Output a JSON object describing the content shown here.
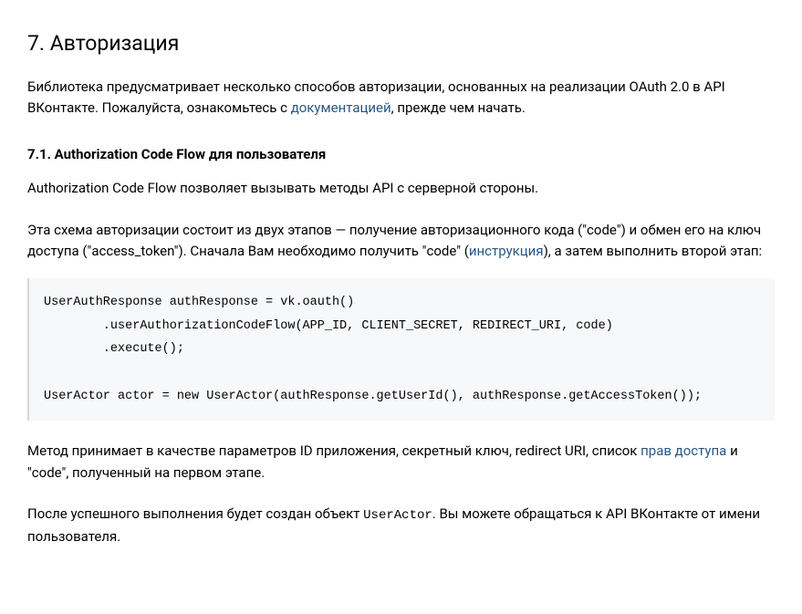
{
  "section": {
    "heading": "7. Авторизация",
    "intro_before_link": "Библиотека предусматривает несколько способов авторизации, основанных на реализации OAuth 2.0 в API ВКонтакте. Пожалуйста, ознакомьтесь с ",
    "intro_link": "документацией",
    "intro_after_link": ", прежде чем начать."
  },
  "subsection": {
    "heading": "7.1. Authorization Code Flow для пользователя",
    "p1": "Authorization Code Flow позволяет вызывать методы API с серверной стороны.",
    "p2_before_link": "Эта схема авторизации состоит из двух этапов — получение авторизационного кода (\"code\") и обмен его на ключ доступа (\"access_token\"). Сначала Вам необходимо получить \"code\" (",
    "p2_link": "инструкция",
    "p2_after_link": "), а затем выполнить второй этап:",
    "codeblock": "UserAuthResponse authResponse = vk.oauth()\n        .userAuthorizationCodeFlow(APP_ID, CLIENT_SECRET, REDIRECT_URI, code)\n        .execute();\n\nUserActor actor = new UserActor(authResponse.getUserId(), authResponse.getAccessToken());",
    "p3_before_link": "Метод принимает в качестве параметров ID приложения, секретный ключ, redirect URI, список ",
    "p3_link": "прав доступа",
    "p3_after_link": " и \"code\", полученный на первом этапе.",
    "p4_before_code": "После успешного выполнения будет создан объект ",
    "p4_code": "UserActor",
    "p4_after_code": ". Вы можете обращаться к API ВКонтакте от имени пользователя."
  }
}
